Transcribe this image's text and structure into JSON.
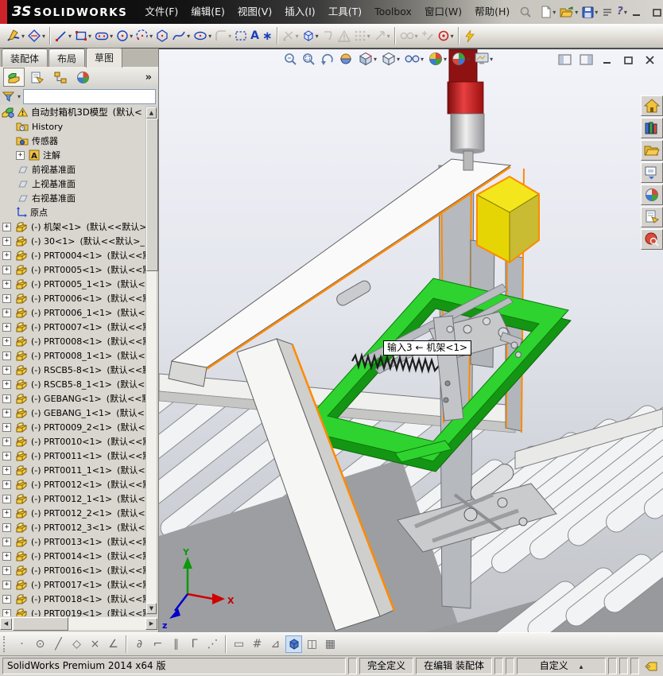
{
  "colors": {
    "highlight_orange": "#ff8a00",
    "frame_green": "#2fd32f",
    "box_yellow": "#f3e61c",
    "cylinder_red": "#d42525",
    "titlebar_red": "#cc2229"
  },
  "titlebar": {
    "brand_mark": "ЗS",
    "brand": "SOLIDWORKS",
    "menus": [
      "文件(F)",
      "编辑(E)",
      "视图(V)",
      "插入(I)",
      "工具(T)",
      "Toolbox",
      "窗口(W)",
      "帮助(H)"
    ],
    "quick_access": [
      {
        "name": "new-document",
        "icon": "new-doc",
        "dropdown": true
      },
      {
        "name": "open-document",
        "icon": "open-folder",
        "dropdown": true
      },
      {
        "name": "save-document",
        "icon": "save",
        "dropdown": true
      },
      {
        "name": "options",
        "icon": "options"
      },
      {
        "name": "help",
        "icon": "help",
        "dropdown": true
      }
    ],
    "window_buttons": [
      "minimize",
      "restore",
      "close"
    ]
  },
  "sketch_toolbar": {
    "tools": [
      {
        "name": "sketch",
        "icon": "sketch-pencil",
        "dropdown": true
      },
      {
        "name": "smart-dimension",
        "icon": "dimension",
        "dropdown": true,
        "separator": true
      },
      {
        "name": "line",
        "icon": "line",
        "dropdown": true
      },
      {
        "name": "corner-rectangle",
        "icon": "rectangle",
        "dropdown": true
      },
      {
        "name": "straight-slot",
        "icon": "slot",
        "dropdown": true
      },
      {
        "name": "circle",
        "icon": "circle",
        "dropdown": true
      },
      {
        "name": "centerpoint-arc",
        "icon": "arc",
        "dropdown": true
      },
      {
        "name": "polygon",
        "icon": "polygon"
      },
      {
        "name": "spline",
        "icon": "spline",
        "dropdown": true
      },
      {
        "name": "ellipse",
        "icon": "ellipse",
        "dropdown": true
      },
      {
        "name": "sketch-fillet",
        "icon": "fillet",
        "dropdown": true,
        "disabled": true
      },
      {
        "name": "selection-box",
        "icon": "selbox"
      },
      {
        "name": "text",
        "icon": "text"
      },
      {
        "name": "point",
        "icon": "point",
        "separator": true
      },
      {
        "name": "trim-entities",
        "icon": "trim",
        "dropdown": true,
        "disabled": true
      },
      {
        "name": "convert-entities",
        "icon": "convert",
        "dropdown": true
      },
      {
        "name": "offset-entities",
        "icon": "offset",
        "disabled": true
      },
      {
        "name": "sketch-warning",
        "icon": "warning",
        "disabled": true
      },
      {
        "name": "linear-sketch-pattern",
        "icon": "pattern",
        "dropdown": true,
        "disabled": true
      },
      {
        "name": "move-entities",
        "icon": "move",
        "dropdown": true,
        "disabled": true,
        "separator": true
      },
      {
        "name": "display-delete-relations",
        "icon": "relations",
        "dropdown": true,
        "disabled": true
      },
      {
        "name": "repair-sketch",
        "icon": "repair",
        "disabled": true
      },
      {
        "name": "quick-snaps",
        "icon": "snaps",
        "dropdown": true,
        "separator": true
      },
      {
        "name": "instant2d",
        "icon": "instant"
      }
    ]
  },
  "tabs": {
    "items": [
      "装配体",
      "布局",
      "草图"
    ],
    "active_index": 2
  },
  "feature_panel": {
    "header_icons": [
      "feature-tree",
      "property-manager",
      "configuration-manager",
      "display-manager"
    ],
    "chevron": "»",
    "filter_value": "",
    "root": {
      "label": "自动封箱机3D模型",
      "suffix": "(默认<",
      "icon": "assembly",
      "warning": true
    },
    "items": [
      {
        "type": "history",
        "label": "History"
      },
      {
        "type": "sensors",
        "label": "传感器"
      },
      {
        "type": "annotations",
        "label": "注解",
        "expandable": true
      },
      {
        "type": "plane",
        "label": "前视基准面"
      },
      {
        "type": "plane",
        "label": "上视基准面"
      },
      {
        "type": "plane",
        "label": "右视基准面"
      },
      {
        "type": "origin",
        "label": "原点"
      },
      {
        "type": "component",
        "prefix": "(-)",
        "label": "机架<1>",
        "suffix": "(默认<<默认>_"
      },
      {
        "type": "component",
        "prefix": "(-)",
        "label": "30<1>",
        "suffix": "(默认<<默认>_"
      },
      {
        "type": "component",
        "prefix": "(-)",
        "label": "PRT0004<1>",
        "suffix": "(默认<<默认>_"
      },
      {
        "type": "component",
        "prefix": "(-)",
        "label": "PRT0005<1>",
        "suffix": "(默认<<默认>_"
      },
      {
        "type": "component",
        "prefix": "(-)",
        "label": "PRT0005_1<1>",
        "suffix": "(默认<<默认>_"
      },
      {
        "type": "component",
        "prefix": "(-)",
        "label": "PRT0006<1>",
        "suffix": "(默认<<默认>_"
      },
      {
        "type": "component",
        "prefix": "(-)",
        "label": "PRT0006_1<1>",
        "suffix": "(默认<<默认>_"
      },
      {
        "type": "component",
        "prefix": "(-)",
        "label": "PRT0007<1>",
        "suffix": "(默认<<默认>_"
      },
      {
        "type": "component",
        "prefix": "(-)",
        "label": "PRT0008<1>",
        "suffix": "(默认<<默认>_"
      },
      {
        "type": "component",
        "prefix": "(-)",
        "label": "PRT0008_1<1>",
        "suffix": "(默认<<默认>_"
      },
      {
        "type": "component",
        "prefix": "(-)",
        "label": "RSCB5-8<1>",
        "suffix": "(默认<<默认>_"
      },
      {
        "type": "component",
        "prefix": "(-)",
        "label": "RSCB5-8_1<1>",
        "suffix": "(默认<<默认>_"
      },
      {
        "type": "component",
        "prefix": "(-)",
        "label": "GEBANG<1>",
        "suffix": "(默认<<默认>_"
      },
      {
        "type": "component",
        "prefix": "(-)",
        "label": "GEBANG_1<1>",
        "suffix": "(默认<<默认>_"
      },
      {
        "type": "component",
        "prefix": "(-)",
        "label": "PRT0009_2<1>",
        "suffix": "(默认<<默认>_"
      },
      {
        "type": "component",
        "prefix": "(-)",
        "label": "PRT0010<1>",
        "suffix": "(默认<<默认>_"
      },
      {
        "type": "component",
        "prefix": "(-)",
        "label": "PRT0011<1>",
        "suffix": "(默认<<默认>_"
      },
      {
        "type": "component",
        "prefix": "(-)",
        "label": "PRT0011_1<1>",
        "suffix": "(默认<<默认>_"
      },
      {
        "type": "component",
        "prefix": "(-)",
        "label": "PRT0012<1>",
        "suffix": "(默认<<默认>_"
      },
      {
        "type": "component",
        "prefix": "(-)",
        "label": "PRT0012_1<1>",
        "suffix": "(默认<<默认>_"
      },
      {
        "type": "component",
        "prefix": "(-)",
        "label": "PRT0012_2<1>",
        "suffix": "(默认<<默认>_"
      },
      {
        "type": "component",
        "prefix": "(-)",
        "label": "PRT0012_3<1>",
        "suffix": "(默认<<默认>_"
      },
      {
        "type": "component",
        "prefix": "(-)",
        "label": "PRT0013<1>",
        "suffix": "(默认<<默认>_"
      },
      {
        "type": "component",
        "prefix": "(-)",
        "label": "PRT0014<1>",
        "suffix": "(默认<<默认>_"
      },
      {
        "type": "component",
        "prefix": "(-)",
        "label": "PRT0016<1>",
        "suffix": "(默认<<默认>_"
      },
      {
        "type": "component",
        "prefix": "(-)",
        "label": "PRT0017<1>",
        "suffix": "(默认<<默认>_"
      },
      {
        "type": "component",
        "prefix": "(-)",
        "label": "PRT0018<1>",
        "suffix": "(默认<<默认>_"
      },
      {
        "type": "component",
        "prefix": "(-)",
        "label": "PRT0019<1>",
        "suffix": "(默认<<默认>_"
      }
    ]
  },
  "viewport": {
    "headsup": [
      {
        "name": "zoom-fit"
      },
      {
        "name": "zoom-to-area"
      },
      {
        "name": "previous-view"
      },
      {
        "name": "section-view"
      },
      {
        "name": "view-orientation",
        "dropdown": true
      },
      {
        "name": "display-style",
        "dropdown": true
      },
      {
        "name": "hide-show-items",
        "dropdown": true
      },
      {
        "name": "edit-appearance",
        "dropdown": true
      },
      {
        "name": "apply-scene",
        "dropdown": true
      },
      {
        "name": "view-settings",
        "dropdown": true
      }
    ],
    "doc_window_buttons": [
      "pane-left",
      "pane-right",
      "minimize",
      "restore",
      "close"
    ],
    "task_pane": [
      "solidworks-resources",
      "design-library",
      "file-explorer",
      "view-palette",
      "appearances",
      "custom-properties",
      "solidworks-forum"
    ],
    "tooltip": "输入3 ← 机架<1>",
    "triad": {
      "x": "X",
      "y": "Y",
      "z": "z"
    }
  },
  "snap_toolbar": {
    "items": [
      {
        "name": "point-snap",
        "glyph": "·"
      },
      {
        "name": "center-snap",
        "glyph": "⊙"
      },
      {
        "name": "line-snap",
        "glyph": "╱"
      },
      {
        "name": "polygon-snap",
        "glyph": "◇"
      },
      {
        "name": "intersection-snap",
        "glyph": "×"
      },
      {
        "name": "angle-snap",
        "glyph": "∠"
      },
      {
        "separator": true
      },
      {
        "name": "tangent-snap",
        "glyph": "∂"
      },
      {
        "name": "nearest-snap",
        "glyph": "⌐"
      },
      {
        "name": "parallel-snap",
        "glyph": "∥"
      },
      {
        "name": "corner-snap",
        "glyph": "Γ"
      },
      {
        "name": "points-snap",
        "glyph": "⋰"
      },
      {
        "separator": true
      },
      {
        "name": "ruler-snap",
        "glyph": "▭"
      },
      {
        "name": "grid-snap",
        "glyph": "#"
      },
      {
        "name": "triangle-snap",
        "glyph": "⊿"
      },
      {
        "name": "shaded-view",
        "icon": "view-cube",
        "active": true
      },
      {
        "name": "split-view",
        "glyph": "◫"
      },
      {
        "name": "table-view",
        "glyph": "▦"
      }
    ]
  },
  "statusbar": {
    "left": "SolidWorks Premium 2014 x64 版",
    "cells": [
      {
        "name": "define-status",
        "label": "完全定义"
      },
      {
        "name": "edit-status",
        "label": "在编辑 装配体"
      },
      {
        "name": "unit-system",
        "label": "自定义",
        "arrow": "▴"
      }
    ]
  }
}
